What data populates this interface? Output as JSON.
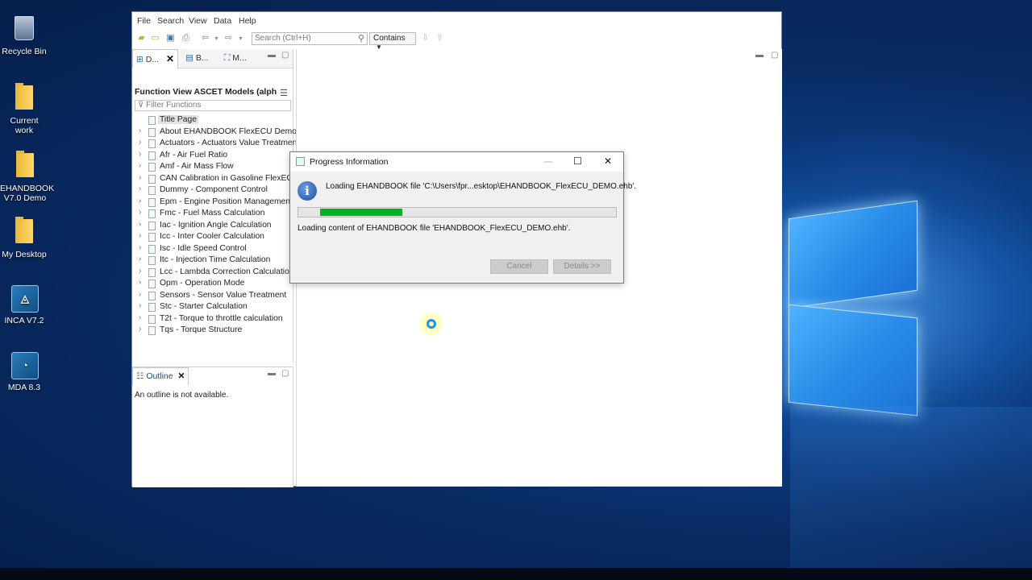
{
  "desktop": {
    "icons": [
      {
        "label": "Recycle Bin",
        "icon": "recycle-bin-icon"
      },
      {
        "label": "Current work",
        "icon": "folder-icon"
      },
      {
        "label": "EHANDBOOK V7.0 Demo",
        "icon": "folder-icon"
      },
      {
        "label": "My Desktop",
        "icon": "folder-icon"
      },
      {
        "label": "INCA V7.2",
        "icon": "inca-app-icon"
      },
      {
        "label": "MDA 8.3",
        "icon": "mda-app-icon"
      }
    ]
  },
  "app": {
    "menu": [
      "File",
      "Search",
      "View",
      "Data",
      "Help"
    ],
    "toolbar": {
      "search_placeholder": "Search (Ctrl+H)",
      "contains_label": "Contains"
    },
    "left_pane": {
      "tabs": [
        "D...",
        "B...",
        "M..."
      ],
      "heading": "Function View ASCET Models (alphabeti",
      "filter_placeholder": "Filter Functions",
      "tree": [
        "Title Page",
        "About EHANDBOOK FlexECU Demo",
        "Actuators - Actuators Value Treatment",
        "Afr - Air Fuel Ratio",
        "Amf - Air Mass Flow",
        "CAN Calibration in Gasoline FlexECU",
        "Dummy - Component Control",
        "Epm - Engine Position Management",
        "Fmc - Fuel Mass Calculation",
        "Iac - Ignition Angle Calculation",
        "Icc - Inter Cooler Calculation",
        "Isc - Idle Speed Control",
        "Itc - Injection Time Calculation",
        "Lcc - Lambda Correction Calculation",
        "Opm - Operation Mode",
        "Sensors - Sensor Value Treatment",
        "Stc - Starter Calculation",
        "T2t - Torque to throttle calculation",
        "Tqs - Torque Structure"
      ]
    },
    "outline": {
      "tab_label": "Outline",
      "empty_text": "An outline is not available."
    }
  },
  "dialog": {
    "title": "Progress Information",
    "message": "Loading EHANDBOOK file 'C:\\Users\\fpr...esktop\\EHANDBOOK_FlexECU_DEMO.ehb'.",
    "sub_message": "Loading content of EHANDBOOK file 'EHANDBOOK_FlexECU_DEMO.ehb'.",
    "progress": 0.26,
    "cancel_label": "Cancel",
    "details_label": "Details >>"
  },
  "colors": {
    "progress_fill": "#06b025",
    "desktop_bg": "#0d3f86"
  }
}
